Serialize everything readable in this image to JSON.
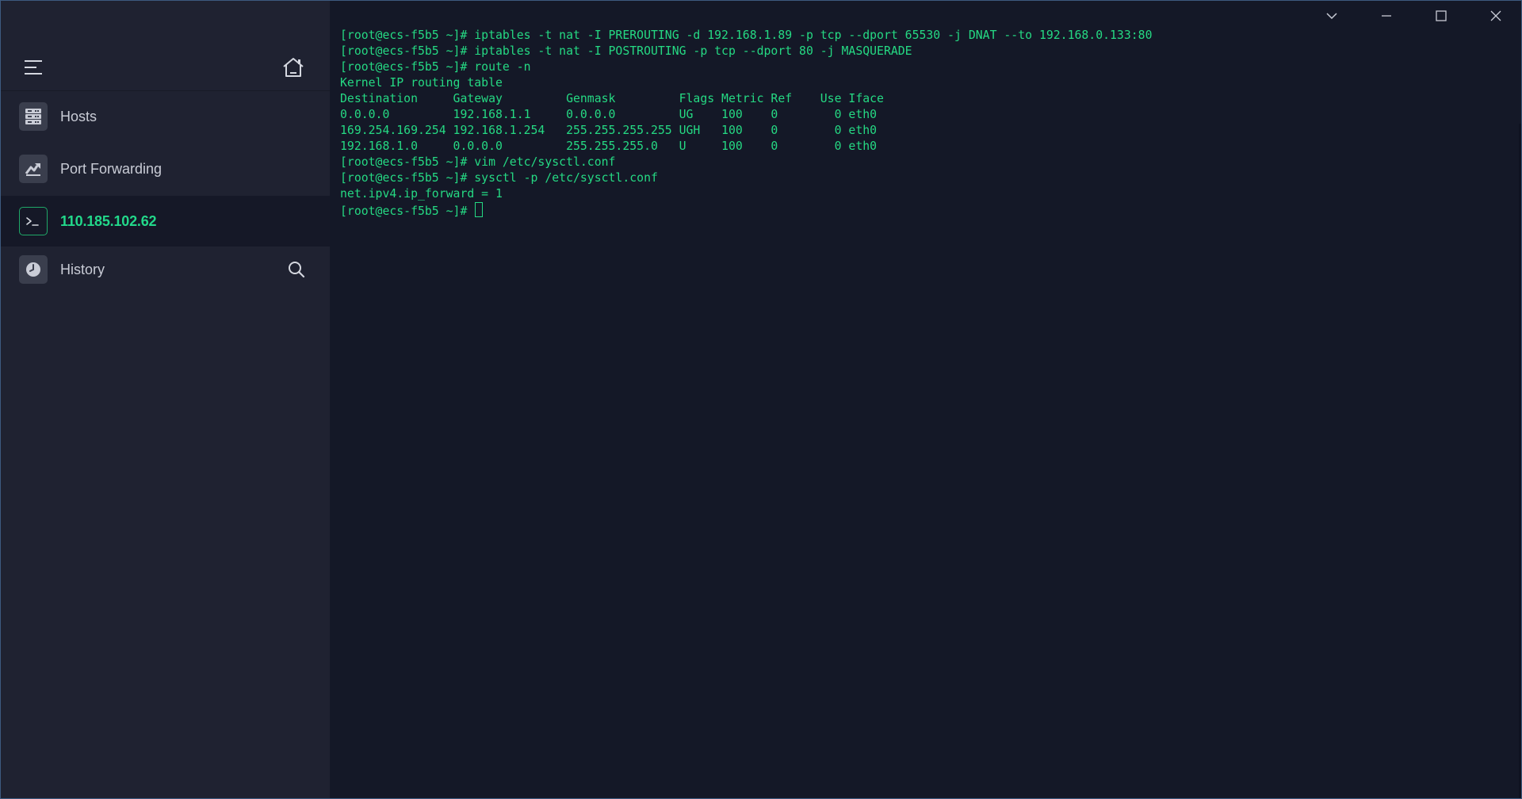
{
  "sidebar": {
    "items": [
      {
        "label": "Hosts",
        "icon": "server-icon"
      },
      {
        "label": "Port Forwarding",
        "icon": "port-forwarding-icon"
      },
      {
        "label": "110.185.102.62",
        "icon": "terminal-icon",
        "active": true
      },
      {
        "label": "History",
        "icon": "history-icon"
      }
    ]
  },
  "terminal": {
    "lines": [
      "[root@ecs-f5b5 ~]# iptables -t nat -I PREROUTING -d 192.168.1.89 -p tcp --dport 65530 -j DNAT --to 192.168.0.133:80",
      "[root@ecs-f5b5 ~]# iptables -t nat -I POSTROUTING -p tcp --dport 80 -j MASQUERADE",
      "[root@ecs-f5b5 ~]# route -n",
      "Kernel IP routing table",
      "Destination     Gateway         Genmask         Flags Metric Ref    Use Iface",
      "0.0.0.0         192.168.1.1     0.0.0.0         UG    100    0        0 eth0",
      "169.254.169.254 192.168.1.254   255.255.255.255 UGH   100    0        0 eth0",
      "192.168.1.0     0.0.0.0         255.255.255.0   U     100    0        0 eth0",
      "[root@ecs-f5b5 ~]# vim /etc/sysctl.conf",
      "[root@ecs-f5b5 ~]# sysctl -p /etc/sysctl.conf",
      "net.ipv4.ip_forward = 1"
    ],
    "prompt": "[root@ecs-f5b5 ~]# "
  },
  "colors": {
    "terminal_text": "#25d983",
    "terminal_bg": "#141827",
    "sidebar_bg": "#1f2231",
    "accent": "#22d88a"
  }
}
